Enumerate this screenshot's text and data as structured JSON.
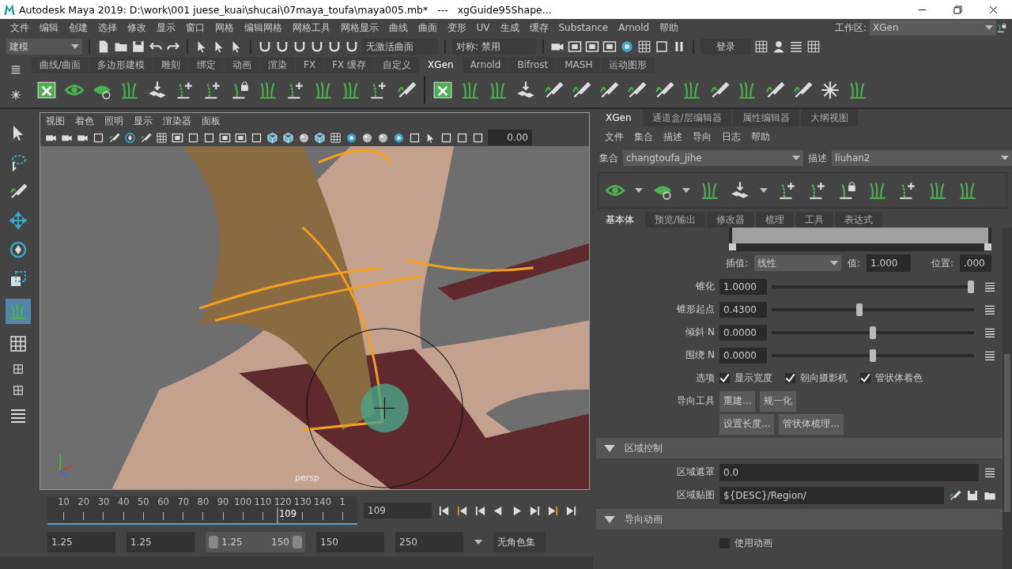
{
  "title_bar": {
    "title": "Autodesk Maya 2019: D:\\work\\001 juese_kuai\\shucai\\07maya_toufa\\maya005.mb*   ---   xgGuide95Shape..."
  },
  "menu_bar": {
    "items": [
      "文件",
      "编辑",
      "创建",
      "选择",
      "修改",
      "显示",
      "窗口",
      "网格",
      "编辑网格",
      "网格工具",
      "网格显示",
      "曲线",
      "曲面",
      "变形",
      "UV",
      "生成",
      "缓存",
      "Substance",
      "Arnold",
      "帮助"
    ],
    "workspace_label": "工作区:",
    "workspace": "XGen"
  },
  "status_line": {
    "mode": "建模",
    "live_surface": "无激活曲面",
    "symmetry": "对称: 禁用",
    "login": "登录"
  },
  "shelf": {
    "tabs": [
      {
        "label": "曲线/曲面",
        "selected": false
      },
      {
        "label": "多边形建模",
        "selected": false
      },
      {
        "label": "雕刻",
        "selected": false
      },
      {
        "label": "绑定",
        "selected": false
      },
      {
        "label": "动画",
        "selected": false
      },
      {
        "label": "渲染",
        "selected": false
      },
      {
        "label": "FX",
        "selected": false
      },
      {
        "label": "FX 缓存",
        "selected": false
      },
      {
        "label": "自定义",
        "selected": false
      },
      {
        "label": "XGen",
        "selected": true
      },
      {
        "label": "Arnold",
        "selected": false
      },
      {
        "label": "Bifrost",
        "selected": false
      },
      {
        "label": "MASH",
        "selected": false
      },
      {
        "label": "运动图形",
        "selected": false
      }
    ]
  },
  "viewport": {
    "menu": [
      "视图",
      "着色",
      "照明",
      "显示",
      "渲染器",
      "面板"
    ],
    "exposure": "0.00",
    "camera": "persp"
  },
  "xgen_panel": {
    "tabs": [
      {
        "label": "XGen",
        "selected": true
      },
      {
        "label": "通道盒/层编辑器",
        "selected": false
      },
      {
        "label": "属性编辑器",
        "selected": false
      },
      {
        "label": "大纲视图",
        "selected": false
      }
    ],
    "menu": [
      "文件",
      "集合",
      "描述",
      "导向",
      "日志",
      "帮助"
    ],
    "collection": {
      "label": "集合",
      "value": "changtoufa_jihe"
    },
    "description": {
      "label": "描述",
      "value": "liuhan2"
    },
    "sub_tabs": [
      {
        "label": "基本体",
        "selected": true
      },
      {
        "label": "预览/输出",
        "selected": false
      },
      {
        "label": "修改器",
        "selected": false
      },
      {
        "label": "梳理",
        "selected": false
      },
      {
        "label": "工具",
        "selected": false
      },
      {
        "label": "表达式",
        "selected": false
      }
    ],
    "ramp": {
      "interp_label": "插值:",
      "interp": "线性",
      "value_label": "值:",
      "value": "1.000",
      "position_label": "位置:",
      "position": ".000"
    },
    "sliders": [
      {
        "label": "锥化",
        "value": "1.0000",
        "level": 1
      },
      {
        "label": "锥形起点",
        "value": "0.4300",
        "level": 0.43
      },
      {
        "label": "倾斜 N",
        "value": "0.0000",
        "level": 0.5
      },
      {
        "label": "围绕 N",
        "value": "0.0000",
        "level": 0.5
      }
    ],
    "options": {
      "label": "选项",
      "items": [
        {
          "label": "显示宽度",
          "checked": true
        },
        {
          "label": "朝向摄影机",
          "checked": true
        },
        {
          "label": "管状体着色",
          "checked": true
        }
      ]
    },
    "guide_tools": {
      "label": "导向工具",
      "buttons": [
        "重建...",
        "规一化",
        "设置长度...",
        "管状体梳理..."
      ]
    },
    "sections": [
      {
        "title": "区域控制",
        "expanded": true,
        "rows": [
          {
            "kind": "field",
            "label": "区域遮罩",
            "value": "0.0"
          },
          {
            "kind": "map",
            "label": "区域贴图",
            "value": "${DESC}/Region/"
          }
        ]
      },
      {
        "title": "导向动画",
        "expanded": true,
        "rows": [
          {
            "kind": "checkbox",
            "label": "使用动画",
            "checked": false
          }
        ]
      }
    ]
  },
  "time_slider": {
    "ticks": [
      "10",
      "20",
      "30",
      "40",
      "50",
      "60",
      "70",
      "80",
      "90",
      "100",
      "110",
      "120",
      "130",
      "140",
      "1"
    ],
    "current": "109",
    "level": 0.745,
    "frame_field": "109"
  },
  "range_slider": {
    "level": 1,
    "start": "1.25",
    "playback_start": "1.25",
    "handle_start": "1.25",
    "handle_end": "150",
    "playback_end": "150",
    "end": "250",
    "character_set": "无角色集"
  }
}
